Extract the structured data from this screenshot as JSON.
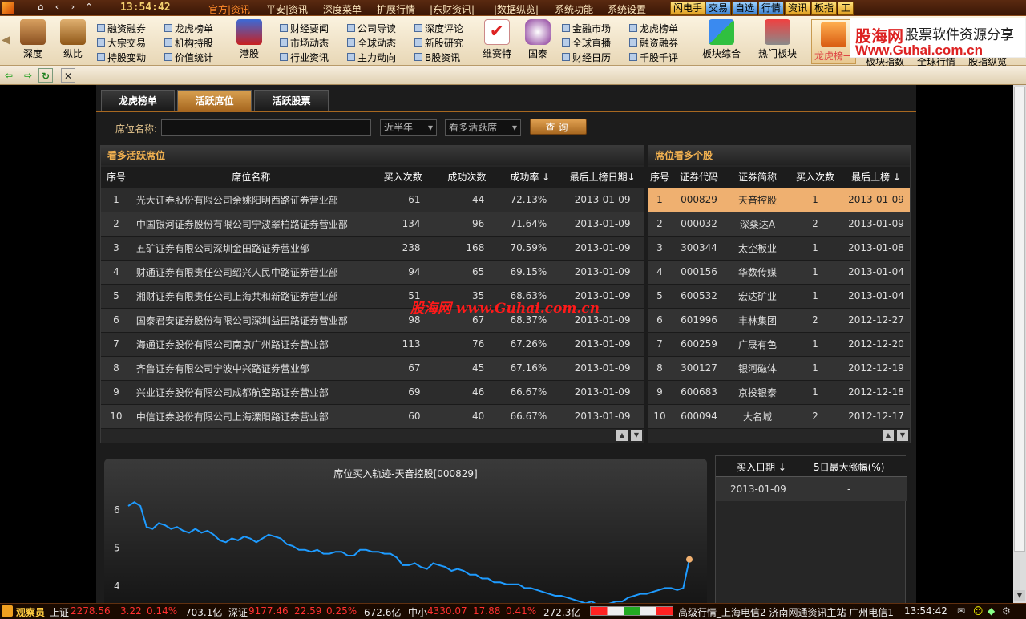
{
  "topbar": {
    "clock": "13:54:42",
    "menus": [
      "官方|资讯",
      "平安|资讯",
      "深度菜单",
      "扩展行情",
      "|东财资讯|",
      "|数据纵览|",
      "系统功能",
      "系统设置"
    ],
    "quick": [
      "闪电手",
      "交易",
      "自选",
      "行情",
      "资讯",
      "板指",
      "工"
    ]
  },
  "logo": {
    "line1": "股海网",
    "line2": "股票软件资源分享",
    "line3": "Www.Guhai.com.cn"
  },
  "toolbar": {
    "big": [
      "深度",
      "纵比",
      "港股",
      "维赛特",
      "国泰",
      "板块综合",
      "热门板块",
      "龙虎榜一"
    ],
    "col1": [
      "融资融券",
      "大宗交易",
      "持股变动"
    ],
    "col2": [
      "龙虎榜单",
      "机构持股",
      "价值统计"
    ],
    "col3": [
      "财经要闻",
      "市场动态",
      "行业资讯"
    ],
    "col4": [
      "公司导读",
      "全球动态",
      "主力动向"
    ],
    "col5": [
      "深度评论",
      "新股研究",
      "B股资讯"
    ],
    "col6": [
      "金融市场",
      "全球直播",
      "财经日历"
    ],
    "col7": [
      "龙虎榜单",
      "融资融券",
      "千股千评"
    ],
    "right_tabs": [
      "板块指数",
      "全球行情",
      "股指纵览"
    ]
  },
  "tabs": [
    "龙虎榜单",
    "活跃席位",
    "活跃股票"
  ],
  "filter": {
    "label": "席位名称:",
    "value": "",
    "period": "近半年",
    "type": "看多活跃席",
    "query": "查询"
  },
  "left_panel": {
    "title": "看多活跃席位",
    "headers": [
      "序号",
      "席位名称",
      "买入次数",
      "成功次数",
      "成功率 ↓",
      "最后上榜日期↓"
    ],
    "rows": [
      [
        "1",
        "光大证券股份有限公司余姚阳明西路证券营业部",
        "61",
        "44",
        "72.13%",
        "2013-01-09"
      ],
      [
        "2",
        "中国银河证券股份有限公司宁波翠柏路证券营业部",
        "134",
        "96",
        "71.64%",
        "2013-01-09"
      ],
      [
        "3",
        "五矿证券有限公司深圳金田路证券营业部",
        "238",
        "168",
        "70.59%",
        "2013-01-09"
      ],
      [
        "4",
        "财通证券有限责任公司绍兴人民中路证券营业部",
        "94",
        "65",
        "69.15%",
        "2013-01-09"
      ],
      [
        "5",
        "湘财证券有限责任公司上海共和新路证券营业部",
        "51",
        "35",
        "68.63%",
        "2013-01-09"
      ],
      [
        "6",
        "国泰君安证券股份有限公司深圳益田路证券营业部",
        "98",
        "67",
        "68.37%",
        "2013-01-09"
      ],
      [
        "7",
        "海通证券股份有限公司南京广州路证券营业部",
        "113",
        "76",
        "67.26%",
        "2013-01-09"
      ],
      [
        "8",
        "齐鲁证券有限公司宁波中兴路证券营业部",
        "67",
        "45",
        "67.16%",
        "2013-01-09"
      ],
      [
        "9",
        "兴业证券股份有限公司成都航空路证券营业部",
        "69",
        "46",
        "66.67%",
        "2013-01-09"
      ],
      [
        "10",
        "中信证券股份有限公司上海溧阳路证券营业部",
        "60",
        "40",
        "66.67%",
        "2013-01-09"
      ]
    ]
  },
  "right_panel": {
    "title": "席位看多个股",
    "headers": [
      "序号",
      "证券代码",
      "证券简称",
      "买入次数",
      "最后上榜 ↓"
    ],
    "rows": [
      [
        "1",
        "000829",
        "天音控股",
        "1",
        "2013-01-09"
      ],
      [
        "2",
        "000032",
        "深桑达A",
        "2",
        "2013-01-09"
      ],
      [
        "3",
        "300344",
        "太空板业",
        "1",
        "2013-01-08"
      ],
      [
        "4",
        "000156",
        "华数传媒",
        "1",
        "2013-01-04"
      ],
      [
        "5",
        "600532",
        "宏达矿业",
        "1",
        "2013-01-04"
      ],
      [
        "6",
        "601996",
        "丰林集团",
        "2",
        "2012-12-27"
      ],
      [
        "7",
        "600259",
        "广晟有色",
        "1",
        "2012-12-20"
      ],
      [
        "8",
        "300127",
        "银河磁体",
        "1",
        "2012-12-19"
      ],
      [
        "9",
        "600683",
        "京投银泰",
        "1",
        "2012-12-18"
      ],
      [
        "10",
        "600094",
        "大名城",
        "2",
        "2012-12-17"
      ]
    ]
  },
  "watermark": "股海网 www.Guhai.com.cn",
  "info_panel": {
    "headers": [
      "买入日期 ↓",
      "5日最大涨幅(%)"
    ],
    "row": [
      "2013-01-09",
      "-"
    ]
  },
  "chart_data": {
    "type": "line",
    "title": "席位买入轨迹-天音控股[000829]",
    "yticks": [
      "6",
      "5",
      "4"
    ],
    "ylim": [
      3.35,
      6.5
    ],
    "values": [
      6.1,
      6.2,
      6.1,
      5.55,
      5.5,
      5.65,
      5.6,
      5.5,
      5.55,
      5.45,
      5.4,
      5.5,
      5.4,
      5.45,
      5.35,
      5.2,
      5.15,
      5.25,
      5.2,
      5.3,
      5.25,
      5.15,
      5.25,
      5.35,
      5.3,
      5.25,
      5.1,
      5.05,
      4.95,
      4.95,
      4.9,
      4.95,
      4.85,
      4.85,
      4.9,
      4.9,
      4.8,
      4.8,
      4.95,
      4.95,
      4.9,
      4.9,
      4.85,
      4.85,
      4.75,
      4.55,
      4.55,
      4.6,
      4.5,
      4.45,
      4.6,
      4.55,
      4.5,
      4.4,
      4.45,
      4.4,
      4.3,
      4.3,
      4.2,
      4.2,
      4.1,
      4.1,
      4.05,
      4.05,
      4.05,
      3.95,
      3.95,
      3.9,
      3.85,
      3.8,
      3.75,
      3.75,
      3.7,
      3.65,
      3.6,
      3.55,
      3.6,
      3.5,
      3.5,
      3.55,
      3.6,
      3.6,
      3.7,
      3.75,
      3.8,
      3.8,
      3.85,
      3.9,
      3.95,
      3.95,
      3.9,
      3.95,
      4.7
    ],
    "marker_index": 92,
    "line_color": "#1e9bff",
    "marker_color": "#f0b070"
  },
  "status": {
    "label": "观察员",
    "sh": "上证",
    "sh_val": "2278.56",
    "sh_chg": "3.22",
    "sh_pct": "0.14%",
    "sh_amt": "703.1亿",
    "sz": "深证",
    "sz_val": "9177.46",
    "sz_chg": "22.59",
    "sz_pct": "0.25%",
    "sz_amt": "672.6亿",
    "zx": "中小",
    "zx_val": "4330.07",
    "zx_chg": "17.88",
    "zx_pct": "0.41%",
    "zx_amt": "272.3亿",
    "server": "高级行情_上海电信2 济南网通资讯主站 广州电信1",
    "time": "13:54:42"
  }
}
